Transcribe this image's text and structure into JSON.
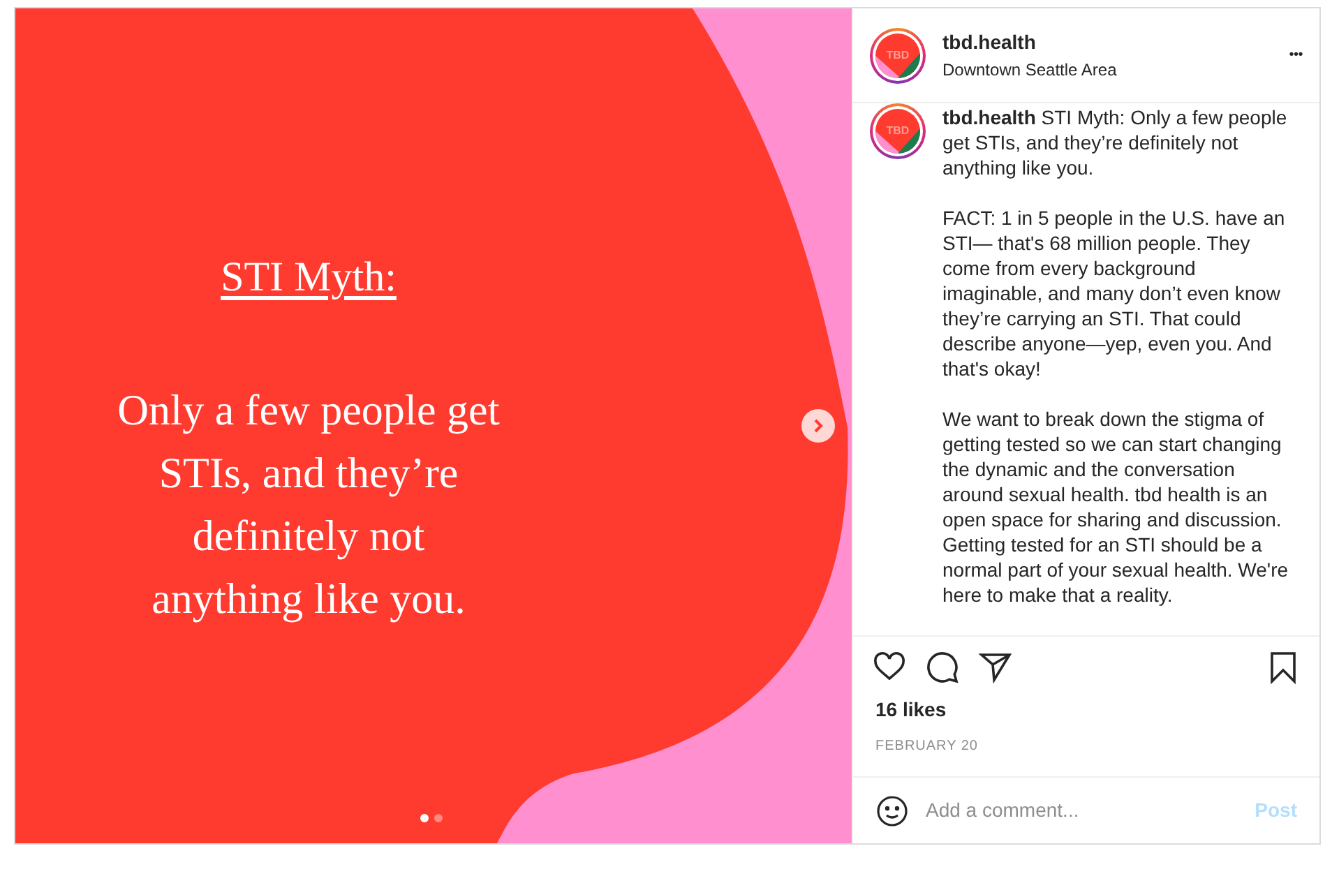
{
  "slide": {
    "heading": "STI Myth:",
    "body": "Only a few people get STIs, and they’re definitely not anything like you.",
    "dots": [
      {
        "selected": true
      },
      {
        "selected": false
      }
    ]
  },
  "header": {
    "avatar_text": "TBD",
    "username": "tbd.health",
    "location": "Downtown Seattle Area",
    "more": "•••"
  },
  "caption": {
    "avatar_text": "TBD",
    "paragraphs": [
      "**tbd.health** STI Myth: Only a few people get STIs, and they’re definitely not anything like you.",
      "FACT: 1 in 5 people in the U.S. have an STI— that's 68 million people. They come from every background imaginable, and many don’t even know they’re carrying an STI. That could describe anyone—yep, even you. And that's okay!",
      "We want to break down the stigma of getting tested so we can start changing the dynamic and the conversation around sexual health. tbd health is an open space for sharing and discussion. Getting tested for an STI should be a normal part of your sexual health. We're here to make that a reality."
    ]
  },
  "likes": "16 likes",
  "date": "FEBRUARY 20",
  "comment": {
    "placeholder": "Add a comment...",
    "post": "Post",
    "post_disabled": true
  }
}
